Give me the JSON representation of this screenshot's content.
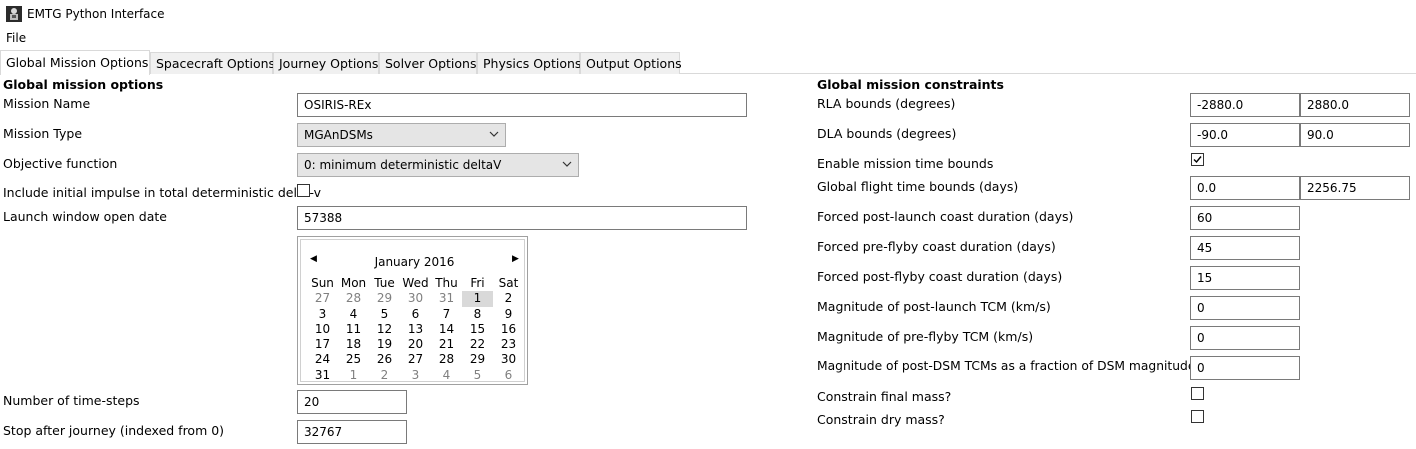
{
  "window": {
    "title": "EMTG Python Interface",
    "icon": "app-icon"
  },
  "menu": {
    "file": "File"
  },
  "tabs": [
    {
      "label": "Global Mission Options",
      "active": true
    },
    {
      "label": "Spacecraft Options"
    },
    {
      "label": "Journey Options"
    },
    {
      "label": "Solver Options"
    },
    {
      "label": "Physics Options"
    },
    {
      "label": "Output Options"
    }
  ],
  "left": {
    "section_title": "Global mission options",
    "mission_name": {
      "label": "Mission Name",
      "value": "OSIRIS-REx"
    },
    "mission_type": {
      "label": "Mission Type",
      "value": "MGAnDSMs"
    },
    "objective": {
      "label": "Objective function",
      "value": "0: minimum deterministic deltaV"
    },
    "include_impulse": {
      "label": "Include initial impulse in total deterministic delta-v",
      "checked": false
    },
    "launch_window": {
      "label": "Launch window open date",
      "value": "57388"
    },
    "calendar": {
      "month": "January 2016",
      "weekdays": [
        "Sun",
        "Mon",
        "Tue",
        "Wed",
        "Thu",
        "Fri",
        "Sat"
      ],
      "weeks": [
        [
          "27",
          "28",
          "29",
          "30",
          "31",
          "1",
          "2"
        ],
        [
          "3",
          "4",
          "5",
          "6",
          "7",
          "8",
          "9"
        ],
        [
          "10",
          "11",
          "12",
          "13",
          "14",
          "15",
          "16"
        ],
        [
          "17",
          "18",
          "19",
          "20",
          "21",
          "22",
          "23"
        ],
        [
          "24",
          "25",
          "26",
          "27",
          "28",
          "29",
          "30"
        ],
        [
          "31",
          "1",
          "2",
          "3",
          "4",
          "5",
          "6"
        ]
      ],
      "selected_day": "1"
    },
    "time_steps": {
      "label": "Number of time-steps",
      "value": "20"
    },
    "stop_after_journey": {
      "label": "Stop after journey (indexed from 0)",
      "value": "32767"
    }
  },
  "right": {
    "section_title": "Global mission constraints",
    "rla": {
      "label": "RLA bounds (degrees)",
      "min": "-2880.0",
      "max": "2880.0"
    },
    "dla": {
      "label": "DLA bounds (degrees)",
      "min": "-90.0",
      "max": "90.0"
    },
    "enable_time_bounds": {
      "label": "Enable mission time bounds",
      "checked": true
    },
    "flight_time": {
      "label": "Global flight time bounds (days)",
      "min": "0.0",
      "max": "2256.75"
    },
    "post_launch_coast": {
      "label": "Forced post-launch coast duration (days)",
      "value": "60"
    },
    "pre_flyby_coast": {
      "label": "Forced pre-flyby coast duration (days)",
      "value": "45"
    },
    "post_flyby_coast": {
      "label": "Forced post-flyby coast duration (days)",
      "value": "15"
    },
    "post_launch_tcm": {
      "label": "Magnitude of post-launch TCM (km/s)",
      "value": "0"
    },
    "pre_flyby_tcm": {
      "label": "Magnitude of pre-flyby TCM (km/s)",
      "value": "0"
    },
    "post_dsm_tcm": {
      "label": "Magnitude of post-DSM TCMs as a fraction of DSM magnitude",
      "value": "0"
    },
    "constrain_final_mass": {
      "label": "Constrain final mass?",
      "checked": false
    },
    "constrain_dry_mass": {
      "label": "Constrain dry mass?",
      "checked": false
    }
  }
}
